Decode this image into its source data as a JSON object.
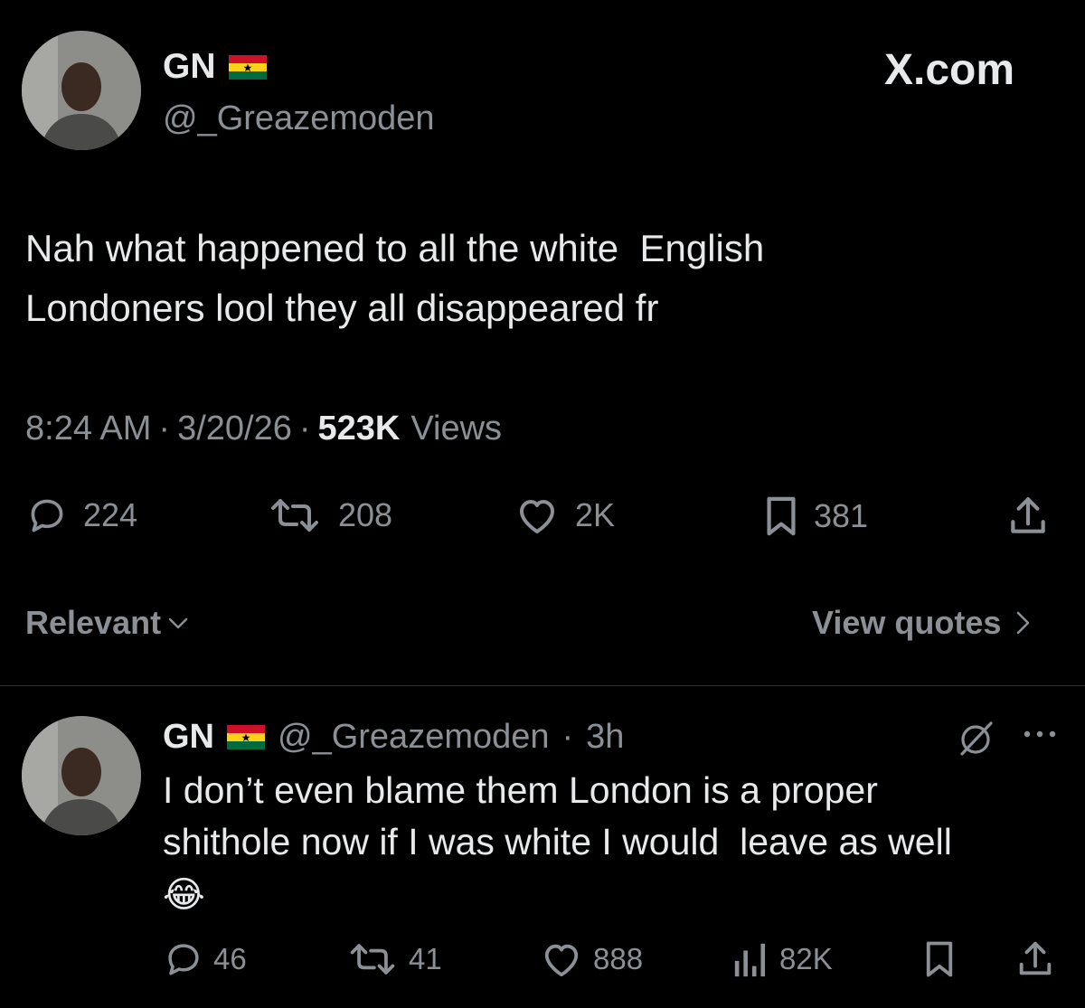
{
  "tweet": {
    "author_name": "GN",
    "author_flag": "ghana-flag",
    "author_handle": "@_Greazemoden",
    "source_label": "X.com",
    "text_line1": "Nah what happened to all the white  English",
    "text_line2": "Londoners lool they all disappeared fr",
    "time": "8:24 AM",
    "date": "3/20/26",
    "views_count": "523K",
    "views_label": "Views",
    "separator": "·",
    "replies": "224",
    "reposts": "208",
    "likes": "2K",
    "bookmarks": "381"
  },
  "replies_bar": {
    "sort_label": "Relevant",
    "quotes_label": "View quotes"
  },
  "reply": {
    "author_name": "GN",
    "author_handle": "@_Greazemoden",
    "age": "3h",
    "separator": "·",
    "text_line1": "I don’t even blame them London is a proper",
    "text_line2": "shithole now if I was white I would  leave as well",
    "emoji": "😂",
    "replies": "46",
    "reposts": "41",
    "likes": "888",
    "views": "82K"
  },
  "colors": {
    "background": "#000000",
    "text_primary": "#e7e9ea",
    "text_secondary": "#8b9096",
    "divider": "#2f3336"
  }
}
